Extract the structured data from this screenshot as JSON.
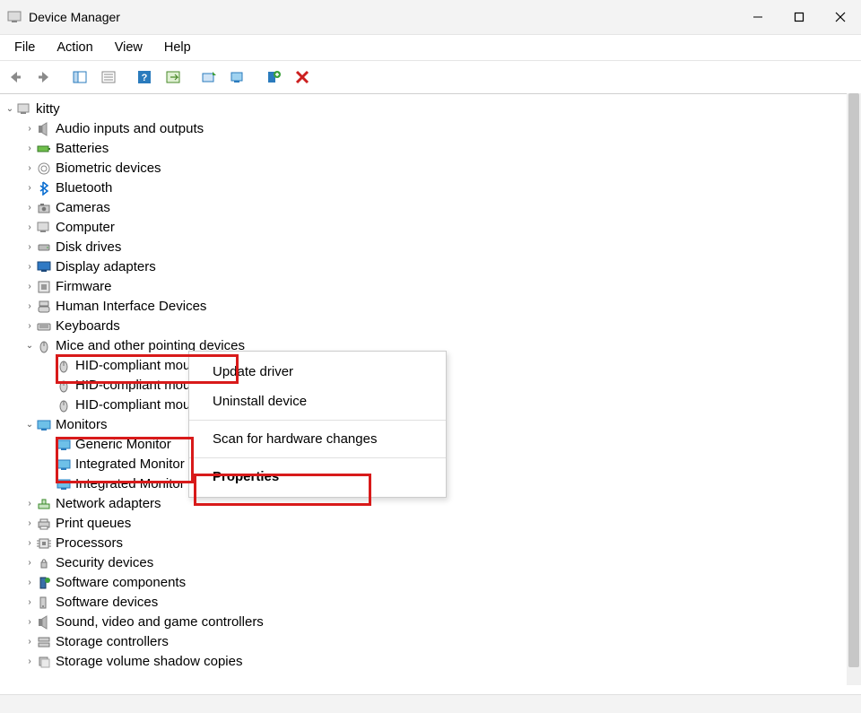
{
  "window": {
    "title": "Device Manager"
  },
  "menubar": {
    "items": [
      "File",
      "Action",
      "View",
      "Help"
    ]
  },
  "tree": {
    "root": "kitty",
    "categories": [
      {
        "label": "Audio inputs and outputs",
        "icon": "speaker",
        "expanded": false
      },
      {
        "label": "Batteries",
        "icon": "battery",
        "expanded": false
      },
      {
        "label": "Biometric devices",
        "icon": "biometric",
        "expanded": false
      },
      {
        "label": "Bluetooth",
        "icon": "bluetooth",
        "expanded": false
      },
      {
        "label": "Cameras",
        "icon": "camera",
        "expanded": false
      },
      {
        "label": "Computer",
        "icon": "computer",
        "expanded": false
      },
      {
        "label": "Disk drives",
        "icon": "disk",
        "expanded": false
      },
      {
        "label": "Display adapters",
        "icon": "display",
        "expanded": false
      },
      {
        "label": "Firmware",
        "icon": "firmware",
        "expanded": false
      },
      {
        "label": "Human Interface Devices",
        "icon": "hid",
        "expanded": false
      },
      {
        "label": "Keyboards",
        "icon": "keyboard",
        "expanded": false
      },
      {
        "label": "Mice and other pointing devices",
        "icon": "mouse",
        "expanded": true,
        "children": [
          {
            "label": "HID-compliant mouse",
            "icon": "mouse"
          },
          {
            "label": "HID-compliant mouse",
            "icon": "mouse"
          },
          {
            "label": "HID-compliant mouse",
            "icon": "mouse"
          }
        ]
      },
      {
        "label": "Monitors",
        "icon": "monitor",
        "expanded": true,
        "children": [
          {
            "label": "Generic Monitor",
            "icon": "monitor"
          },
          {
            "label": "Integrated Monitor",
            "icon": "monitor"
          },
          {
            "label": "Integrated Monitor",
            "icon": "monitor"
          }
        ]
      },
      {
        "label": "Network adapters",
        "icon": "network",
        "expanded": false
      },
      {
        "label": "Print queues",
        "icon": "printer",
        "expanded": false
      },
      {
        "label": "Processors",
        "icon": "cpu",
        "expanded": false
      },
      {
        "label": "Security devices",
        "icon": "security",
        "expanded": false
      },
      {
        "label": "Software components",
        "icon": "softcomp",
        "expanded": false
      },
      {
        "label": "Software devices",
        "icon": "softdev",
        "expanded": false
      },
      {
        "label": "Sound, video and game controllers",
        "icon": "speaker",
        "expanded": false
      },
      {
        "label": "Storage controllers",
        "icon": "storage",
        "expanded": false
      },
      {
        "label": "Storage volume shadow copies",
        "icon": "shadow",
        "expanded": false
      }
    ]
  },
  "context_menu": {
    "items": [
      {
        "label": "Update driver",
        "bold": false
      },
      {
        "label": "Uninstall device",
        "bold": false
      },
      {
        "sep": true
      },
      {
        "label": "Scan for hardware changes",
        "bold": false
      },
      {
        "sep": true
      },
      {
        "label": "Properties",
        "bold": true
      }
    ]
  }
}
